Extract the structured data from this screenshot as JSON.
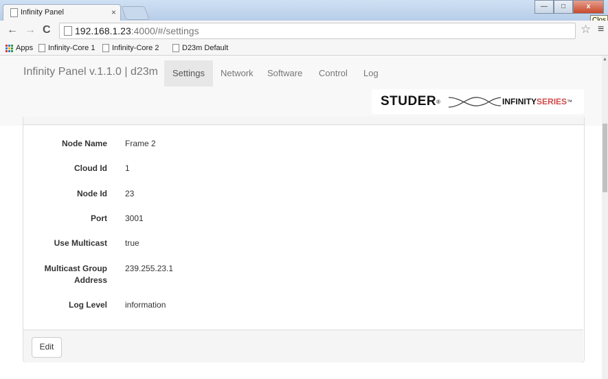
{
  "browser": {
    "tab_title": "Infinity Panel",
    "tab_close": "×",
    "url_host": "192.168.1.23",
    "url_rest": ":4000/#/settings",
    "close_tooltip": "Clos",
    "bookmarks": [
      "Apps",
      "Infinity-Core 1",
      "Infinity-Core 2",
      "D23m Default"
    ]
  },
  "app": {
    "brand": "Infinity Panel v.1.1.0 | d23m",
    "nav": [
      "Settings",
      "Network",
      "Software",
      "Control",
      "Log"
    ],
    "active_nav": "Settings",
    "logo_text": "STUDER",
    "logo_infinity": "INFINITY",
    "logo_series": "SERIES"
  },
  "settings": [
    {
      "label": "Node Name",
      "value": "Frame 2"
    },
    {
      "label": "Cloud Id",
      "value": "1"
    },
    {
      "label": "Node Id",
      "value": "23"
    },
    {
      "label": "Port",
      "value": "3001"
    },
    {
      "label": "Use Multicast",
      "value": "true"
    },
    {
      "label": "Multicast Group Address",
      "value": "239.255.23.1"
    },
    {
      "label": "Log Level",
      "value": "information"
    }
  ],
  "edit_label": "Edit"
}
